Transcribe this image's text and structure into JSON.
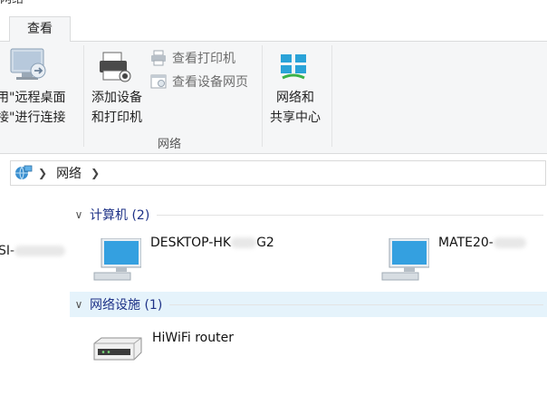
{
  "window": {
    "title_fragment": "网络"
  },
  "tabs": [
    {
      "label": "查看"
    }
  ],
  "ribbon": {
    "remote": {
      "label_line1": "用\"远程桌面",
      "label_line2": "接\"进行连接"
    },
    "add_device": {
      "label_line1": "添加设备",
      "label_line2": "和打印机"
    },
    "view_printers": {
      "label": "查看打印机"
    },
    "view_device_webpage": {
      "label": "查看设备网页"
    },
    "network_center": {
      "label_line1": "网络和",
      "label_line2": "共享中心"
    },
    "group_network_label": "网络"
  },
  "address": {
    "crumb": "网络"
  },
  "navpane": {
    "item_fragment": "SI-"
  },
  "groups": {
    "computers": {
      "title": "计算机 (2)",
      "items": [
        {
          "name_a": "DESKTOP-HK",
          "name_b": "G2"
        },
        {
          "name_a": "MATE20-",
          "name_b": ""
        }
      ]
    },
    "network_infra": {
      "title": "网络设施 (1)",
      "items": [
        {
          "name_a": "HiWiFi router"
        }
      ]
    }
  }
}
